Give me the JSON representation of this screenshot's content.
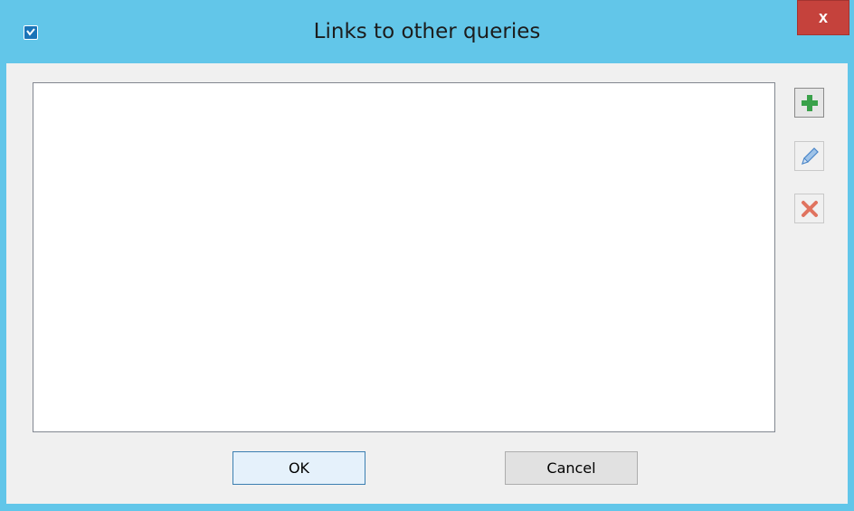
{
  "window": {
    "title": "Links to other queries",
    "close_label": "x"
  },
  "toolbar": {
    "add_icon": "plus-icon",
    "edit_icon": "pencil-icon",
    "delete_icon": "delete-x-icon"
  },
  "links_list": {
    "items": []
  },
  "buttons": {
    "ok_label": "OK",
    "cancel_label": "Cancel"
  },
  "colors": {
    "titlebar": "#62c6e9",
    "close": "#c5423c",
    "add_icon": "#3aa14a",
    "edit_icon": "#4a86c8",
    "delete_icon": "#e0735f"
  }
}
